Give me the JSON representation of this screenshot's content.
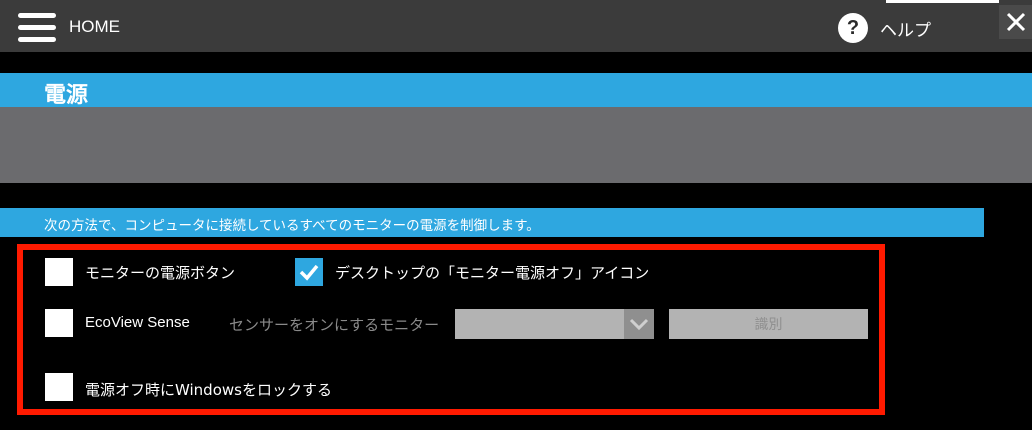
{
  "topbar": {
    "home_label": "HOME",
    "help_label": "ヘルプ",
    "help_icon_glyph": "?",
    "close_glyph": "✕"
  },
  "section": {
    "title": "電源"
  },
  "description": "次の方法で、コンピュータに接続しているすべてのモニターの電源を制御します。",
  "options": {
    "monitor_power_button": {
      "label": "モニターの電源ボタン",
      "checked": false
    },
    "desktop_icon": {
      "label": "デスクトップの「モニター電源オフ」アイコン",
      "checked": true
    },
    "ecoview_sense": {
      "label": "EcoView Sense",
      "checked": false
    },
    "sensor_monitor_label": "センサーをオンにするモニター",
    "sensor_monitor_value": "",
    "identify_button": "識別",
    "lock_windows": {
      "label": "電源オフ時にWindowsをロックする",
      "checked": false
    }
  },
  "colors": {
    "accent_blue": "#2ea7e0",
    "highlight_red": "#ff1a00",
    "topbar_bg": "#3b3b3b",
    "panel_gray": "#6b6b6e",
    "disabled_gray": "#b3b3b3"
  }
}
